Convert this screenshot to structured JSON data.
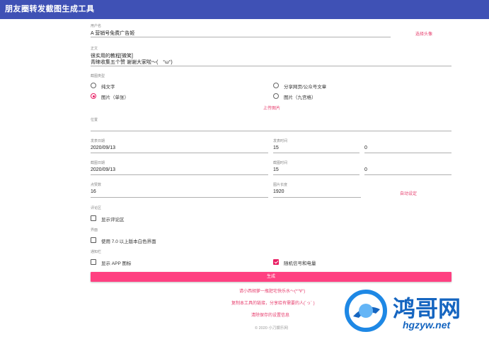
{
  "app": {
    "title": "朋友圈转发截图生成工具"
  },
  "form": {
    "nickname": {
      "label": "用户名",
      "value": "A 营销号免费广告姬"
    },
    "avatar_link": "选择头像",
    "body": {
      "label": "正文",
      "line1": "很实用的教程[微笑]",
      "line2": "青睐收集五个赞 谢谢大家啦～(　°ω°)"
    },
    "screenshot_type": {
      "label": "截图类型",
      "options": [
        "纯文字",
        "分享网页/公众号文章",
        "图片（单张）",
        "图片（九宫格）"
      ],
      "selected": "图片（单张）"
    },
    "upload_link": "上传图片",
    "location": {
      "label": "位置",
      "value": ""
    },
    "post_date": {
      "label": "发表日期",
      "value": "2020/09/13"
    },
    "post_time": {
      "label": "发表时间",
      "hour": "15",
      "minute": "0"
    },
    "shot_date": {
      "label": "截图日期",
      "value": "2020/09/13"
    },
    "shot_time": {
      "label": "截图时间",
      "hour": "15",
      "minute": "0"
    },
    "likes": {
      "label": "点赞数",
      "value": "16"
    },
    "image_height": {
      "label": "图片长度",
      "value": "1920"
    },
    "auto_link": "自动设定",
    "comments": {
      "label": "评论区",
      "option": "显示评论区",
      "checked": false
    },
    "ui": {
      "label": "界面",
      "option": "使用 7.0 以上版本白色界面",
      "checked": false
    },
    "status_bar": {
      "label": "通知栏",
      "option_app": "显示 APP 图标",
      "app_checked": false,
      "option_signal": "随机信号和电量",
      "signal_checked": true
    },
    "generate_label": "生成"
  },
  "footer": {
    "link1": "请小西胡萝一瓶肥宅快乐水～(*°∀°)",
    "link2": "复制本工具的链接，分享给有需要的人(´っ´ )",
    "link3": "清除保存的设置信息",
    "copyright": "© 2020 小刀娱乐网"
  },
  "watermark": {
    "brand": "鸿哥网",
    "url": "hgzyw.net"
  },
  "colors": {
    "appbar": "#3f51b5",
    "accent": "#ff4081",
    "link": "#e63e6d"
  }
}
